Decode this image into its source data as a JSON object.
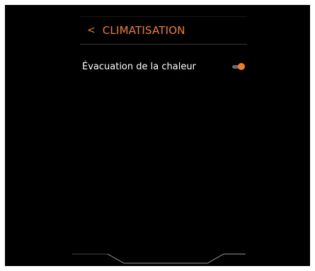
{
  "colors": {
    "background": "#000000",
    "accent": "#f07d2a",
    "text": "#ffffff",
    "divider": "#3a3a3a",
    "toggle_track": "#6a6a6a"
  },
  "header": {
    "back_icon": "chevron-left-icon",
    "back_glyph": "<",
    "title": "CLIMATISATION"
  },
  "settings": {
    "items": [
      {
        "label": "Évacuation de la chaleur",
        "toggle_on": true
      }
    ]
  }
}
